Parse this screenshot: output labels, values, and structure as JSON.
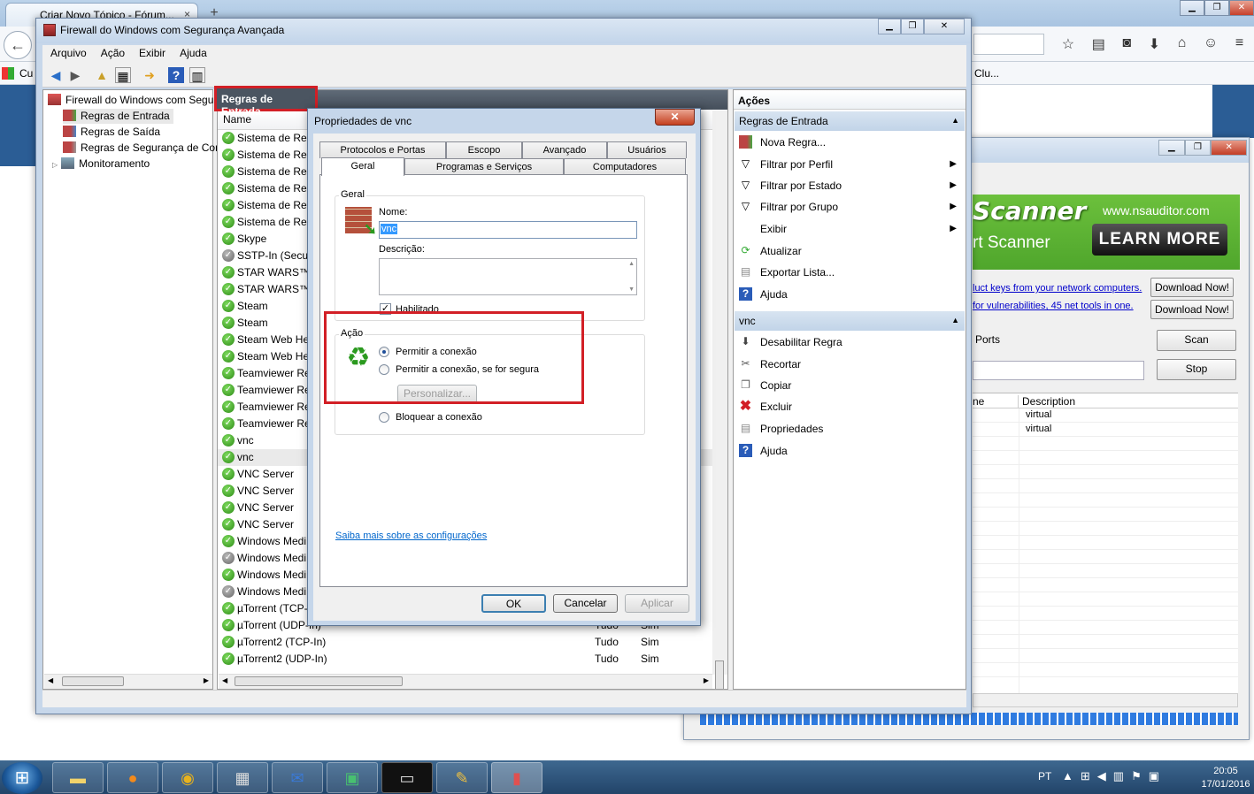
{
  "browser": {
    "tab_title": "Criar Novo Tópico - Fórum...",
    "tab_close": "×",
    "new_tab": "+",
    "bookmark_left": "Cu",
    "bookmark_right": "Clu...",
    "back_icon": "back-arrow-icon"
  },
  "nsauditor": {
    "banner_title": "Scanner",
    "banner_url": "www.nsauditor.com",
    "banner_sub": "rt Scanner",
    "learn_more": "LEARN MORE",
    "link1": "luct keys from your network computers.",
    "link2": "for vulnerabilities, 45 net tools in one.",
    "download1": "Download Now!",
    "download2": "Download Now!",
    "ports_label": "Ports",
    "scan_button": "Scan",
    "stop_button": "Stop",
    "col_name": "ne",
    "col_description": "Description",
    "rows": [
      "virtual",
      "virtual"
    ]
  },
  "firewall": {
    "title": "Firewall do Windows com Segurança Avançada",
    "menu": [
      "Arquivo",
      "Ação",
      "Exibir",
      "Ajuda"
    ],
    "tree": {
      "root": "Firewall do Windows com Segu",
      "inbound": "Regras de Entrada",
      "outbound": "Regras de Saída",
      "connection_security": "Regras de Segurança de Cor",
      "monitoring": "Monitoramento"
    },
    "center_header": "Regras de Entrada",
    "column_name": "Name",
    "rules": [
      {
        "name": "Sistema de Red",
        "enabled": true
      },
      {
        "name": "Sistema de Red",
        "enabled": true
      },
      {
        "name": "Sistema de Red",
        "enabled": true
      },
      {
        "name": "Sistema de Red",
        "enabled": true
      },
      {
        "name": "Sistema de Red",
        "enabled": true
      },
      {
        "name": "Sistema de Red",
        "enabled": true
      },
      {
        "name": "Skype",
        "enabled": true
      },
      {
        "name": "SSTP-In (Secure",
        "enabled": false
      },
      {
        "name": "STAR WARS™ B",
        "enabled": true
      },
      {
        "name": "STAR WARS™ B",
        "enabled": true
      },
      {
        "name": "Steam",
        "enabled": true
      },
      {
        "name": "Steam",
        "enabled": true
      },
      {
        "name": "Steam Web Hel",
        "enabled": true
      },
      {
        "name": "Steam Web Hel",
        "enabled": true
      },
      {
        "name": "Teamviewer Re",
        "enabled": true
      },
      {
        "name": "Teamviewer Re",
        "enabled": true
      },
      {
        "name": "Teamviewer Re",
        "enabled": true
      },
      {
        "name": "Teamviewer Re",
        "enabled": true
      },
      {
        "name": "vnc",
        "enabled": true
      },
      {
        "name": "vnc",
        "enabled": true
      },
      {
        "name": "VNC Server",
        "enabled": true
      },
      {
        "name": "VNC Server",
        "enabled": true
      },
      {
        "name": "VNC Server",
        "enabled": true
      },
      {
        "name": "VNC Server",
        "enabled": true
      },
      {
        "name": "Windows Medi",
        "enabled": true
      },
      {
        "name": "Windows Medi",
        "enabled": false
      },
      {
        "name": "Windows Medi",
        "enabled": true
      },
      {
        "name": "Windows Medi",
        "enabled": false
      },
      {
        "name": "µTorrent (TCP-",
        "enabled": true
      },
      {
        "name": "µTorrent (UDP-In)",
        "enabled": true,
        "profile": "Tudo",
        "on": "Sim"
      },
      {
        "name": "µTorrent2 (TCP-In)",
        "enabled": true,
        "profile": "Tudo",
        "on": "Sim"
      },
      {
        "name": "µTorrent2 (UDP-In)",
        "enabled": true,
        "profile": "Tudo",
        "on": "Sim"
      }
    ],
    "actions_header": "Ações",
    "section_inbound": "Regras de Entrada",
    "actions_inbound": [
      "Nova Regra...",
      "Filtrar por Perfil",
      "Filtrar por Estado",
      "Filtrar por Grupo",
      "Exibir",
      "Atualizar",
      "Exportar Lista...",
      "Ajuda"
    ],
    "section_rule": "vnc",
    "actions_rule": [
      "Desabilitar Regra",
      "Recortar",
      "Copiar",
      "Excluir",
      "Propriedades",
      "Ajuda"
    ]
  },
  "dialog": {
    "title": "Propriedades de vnc",
    "close": "✕",
    "tabs_back": [
      "Protocolos e Portas",
      "Escopo",
      "Avançado",
      "Usuários"
    ],
    "tabs_front": [
      "Geral",
      "Programas e Serviços",
      "Computadores"
    ],
    "group_general": "Geral",
    "name_label": "Nome:",
    "name_value": "vnc",
    "description_label": "Descrição:",
    "enabled_label": "Habilitado",
    "enabled_check": "✓",
    "group_action": "Ação",
    "allow": "Permitir a conexão",
    "allow_secure": "Permitir a conexão, se for segura",
    "customize": "Personalizar...",
    "block": "Bloquear a conexão",
    "learn_link": "Saiba mais sobre as configurações",
    "ok": "OK",
    "cancel": "Cancelar",
    "apply": "Aplicar"
  },
  "taskbar": {
    "lang": "PT",
    "time": "20:05",
    "date": "17/01/2016"
  },
  "colors": {
    "highlight_red": "#d21f26",
    "window_frame": "#c5d6ea",
    "taskbar": "#224469"
  }
}
